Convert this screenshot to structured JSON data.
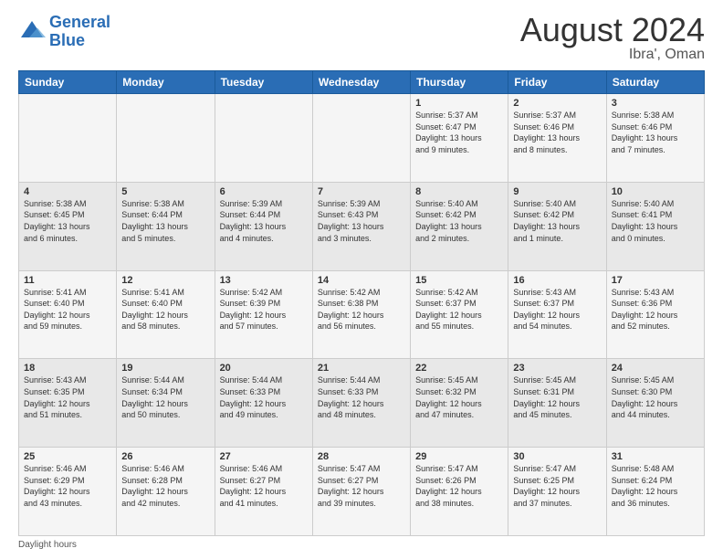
{
  "logo": {
    "line1": "General",
    "line2": "Blue"
  },
  "header": {
    "month": "August 2024",
    "location": "Ibra', Oman"
  },
  "days_header": [
    "Sunday",
    "Monday",
    "Tuesday",
    "Wednesday",
    "Thursday",
    "Friday",
    "Saturday"
  ],
  "weeks": [
    [
      {
        "day": "",
        "info": ""
      },
      {
        "day": "",
        "info": ""
      },
      {
        "day": "",
        "info": ""
      },
      {
        "day": "",
        "info": ""
      },
      {
        "day": "1",
        "info": "Sunrise: 5:37 AM\nSunset: 6:47 PM\nDaylight: 13 hours\nand 9 minutes."
      },
      {
        "day": "2",
        "info": "Sunrise: 5:37 AM\nSunset: 6:46 PM\nDaylight: 13 hours\nand 8 minutes."
      },
      {
        "day": "3",
        "info": "Sunrise: 5:38 AM\nSunset: 6:46 PM\nDaylight: 13 hours\nand 7 minutes."
      }
    ],
    [
      {
        "day": "4",
        "info": "Sunrise: 5:38 AM\nSunset: 6:45 PM\nDaylight: 13 hours\nand 6 minutes."
      },
      {
        "day": "5",
        "info": "Sunrise: 5:38 AM\nSunset: 6:44 PM\nDaylight: 13 hours\nand 5 minutes."
      },
      {
        "day": "6",
        "info": "Sunrise: 5:39 AM\nSunset: 6:44 PM\nDaylight: 13 hours\nand 4 minutes."
      },
      {
        "day": "7",
        "info": "Sunrise: 5:39 AM\nSunset: 6:43 PM\nDaylight: 13 hours\nand 3 minutes."
      },
      {
        "day": "8",
        "info": "Sunrise: 5:40 AM\nSunset: 6:42 PM\nDaylight: 13 hours\nand 2 minutes."
      },
      {
        "day": "9",
        "info": "Sunrise: 5:40 AM\nSunset: 6:42 PM\nDaylight: 13 hours\nand 1 minute."
      },
      {
        "day": "10",
        "info": "Sunrise: 5:40 AM\nSunset: 6:41 PM\nDaylight: 13 hours\nand 0 minutes."
      }
    ],
    [
      {
        "day": "11",
        "info": "Sunrise: 5:41 AM\nSunset: 6:40 PM\nDaylight: 12 hours\nand 59 minutes."
      },
      {
        "day": "12",
        "info": "Sunrise: 5:41 AM\nSunset: 6:40 PM\nDaylight: 12 hours\nand 58 minutes."
      },
      {
        "day": "13",
        "info": "Sunrise: 5:42 AM\nSunset: 6:39 PM\nDaylight: 12 hours\nand 57 minutes."
      },
      {
        "day": "14",
        "info": "Sunrise: 5:42 AM\nSunset: 6:38 PM\nDaylight: 12 hours\nand 56 minutes."
      },
      {
        "day": "15",
        "info": "Sunrise: 5:42 AM\nSunset: 6:37 PM\nDaylight: 12 hours\nand 55 minutes."
      },
      {
        "day": "16",
        "info": "Sunrise: 5:43 AM\nSunset: 6:37 PM\nDaylight: 12 hours\nand 54 minutes."
      },
      {
        "day": "17",
        "info": "Sunrise: 5:43 AM\nSunset: 6:36 PM\nDaylight: 12 hours\nand 52 minutes."
      }
    ],
    [
      {
        "day": "18",
        "info": "Sunrise: 5:43 AM\nSunset: 6:35 PM\nDaylight: 12 hours\nand 51 minutes."
      },
      {
        "day": "19",
        "info": "Sunrise: 5:44 AM\nSunset: 6:34 PM\nDaylight: 12 hours\nand 50 minutes."
      },
      {
        "day": "20",
        "info": "Sunrise: 5:44 AM\nSunset: 6:33 PM\nDaylight: 12 hours\nand 49 minutes."
      },
      {
        "day": "21",
        "info": "Sunrise: 5:44 AM\nSunset: 6:33 PM\nDaylight: 12 hours\nand 48 minutes."
      },
      {
        "day": "22",
        "info": "Sunrise: 5:45 AM\nSunset: 6:32 PM\nDaylight: 12 hours\nand 47 minutes."
      },
      {
        "day": "23",
        "info": "Sunrise: 5:45 AM\nSunset: 6:31 PM\nDaylight: 12 hours\nand 45 minutes."
      },
      {
        "day": "24",
        "info": "Sunrise: 5:45 AM\nSunset: 6:30 PM\nDaylight: 12 hours\nand 44 minutes."
      }
    ],
    [
      {
        "day": "25",
        "info": "Sunrise: 5:46 AM\nSunset: 6:29 PM\nDaylight: 12 hours\nand 43 minutes."
      },
      {
        "day": "26",
        "info": "Sunrise: 5:46 AM\nSunset: 6:28 PM\nDaylight: 12 hours\nand 42 minutes."
      },
      {
        "day": "27",
        "info": "Sunrise: 5:46 AM\nSunset: 6:27 PM\nDaylight: 12 hours\nand 41 minutes."
      },
      {
        "day": "28",
        "info": "Sunrise: 5:47 AM\nSunset: 6:27 PM\nDaylight: 12 hours\nand 39 minutes."
      },
      {
        "day": "29",
        "info": "Sunrise: 5:47 AM\nSunset: 6:26 PM\nDaylight: 12 hours\nand 38 minutes."
      },
      {
        "day": "30",
        "info": "Sunrise: 5:47 AM\nSunset: 6:25 PM\nDaylight: 12 hours\nand 37 minutes."
      },
      {
        "day": "31",
        "info": "Sunrise: 5:48 AM\nSunset: 6:24 PM\nDaylight: 12 hours\nand 36 minutes."
      }
    ]
  ],
  "footer": {
    "note": "Daylight hours"
  }
}
